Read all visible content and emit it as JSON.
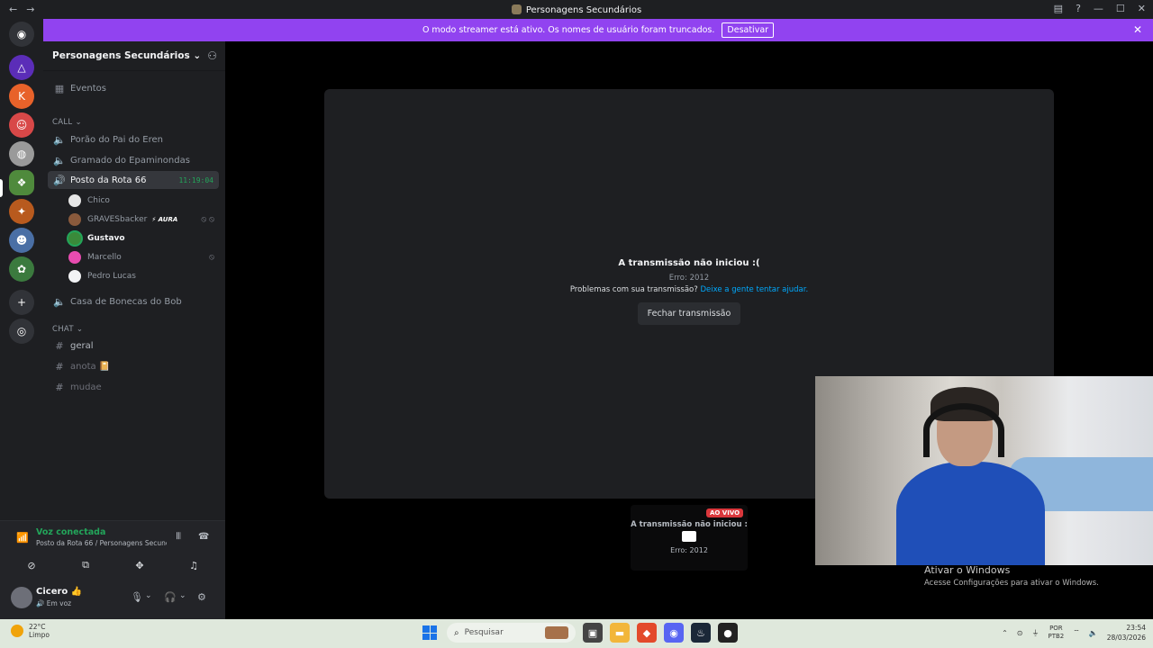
{
  "window": {
    "title": "Personagens Secundários",
    "back": "←",
    "forward": "→",
    "inbox_icon": "inbox-icon",
    "help_icon": "?",
    "minimize": "—",
    "maximize": "☐",
    "close": "✕"
  },
  "banner": {
    "text": "O modo streamer está ativo. Os nomes de usuário foram truncados.",
    "button": "Desativar",
    "close": "✕",
    "color": "#9143f0"
  },
  "servers": [
    {
      "name": "home-discord",
      "glyph": "◉",
      "color": "#313338"
    },
    {
      "name": "server-1",
      "glyph": "△",
      "color": "#5b2db8"
    },
    {
      "name": "server-2",
      "glyph": "K",
      "color": "#e8622a"
    },
    {
      "name": "server-3",
      "glyph": "☺",
      "color": "#d84848"
    },
    {
      "name": "server-4",
      "glyph": "◍",
      "color": "#9a9a9a"
    },
    {
      "name": "server-5",
      "glyph": "❖",
      "color": "#4f8a3c"
    },
    {
      "name": "server-6",
      "glyph": "✦",
      "color": "#b85a1e"
    },
    {
      "name": "server-7",
      "glyph": "☻",
      "color": "#4a6fa5"
    },
    {
      "name": "server-8",
      "glyph": "✿",
      "color": "#3b7a3e"
    },
    {
      "name": "add-server",
      "glyph": "+",
      "color": "#313338"
    },
    {
      "name": "explore",
      "glyph": "◎",
      "color": "#313338"
    }
  ],
  "guild": {
    "name": "Personagens Secundários",
    "chevron": "⌄",
    "add_member": "⚇"
  },
  "sidebar": {
    "events": "Eventos",
    "call_category": "CALL",
    "chat_category": "CHAT",
    "voice_channels": [
      {
        "name": "Porão do Pai do Eren"
      },
      {
        "name": "Gramado do Epaminondas"
      },
      {
        "name": "Posto da Rota 66",
        "timer": "11:19:04"
      },
      {
        "name": "Casa de Bonecas do Bob"
      }
    ],
    "voice_users": [
      {
        "name": "Chico",
        "avatar": "#e6e6e6",
        "right": ""
      },
      {
        "name": "GRAVESbacker",
        "avatar": "#8a5a3c",
        "badge": "⚡ AURA",
        "right": "⦸ ⦸"
      },
      {
        "name": "Gustavo",
        "avatar": "#3a8a3a",
        "right": "",
        "speaking": true
      },
      {
        "name": "Marcello",
        "avatar": "#e84cb0",
        "right": "⦸"
      },
      {
        "name": "Pedro Lucas",
        "avatar": "#f2f3f5",
        "right": ""
      }
    ],
    "text_channels": [
      {
        "name": "geral"
      },
      {
        "name": "anota 📔"
      },
      {
        "name": "mudae"
      }
    ]
  },
  "voice_panel": {
    "status": "Voz conectada",
    "location": "Posto da Rota 66 / Personagens Secund...",
    "buttons": [
      "camera-off",
      "share-screen",
      "activities",
      "soundboard"
    ],
    "button_glyphs": [
      "⊘",
      "⧉",
      "✥",
      "♫"
    ]
  },
  "user_panel": {
    "name": "Cicero 👍",
    "status": "🔊 Em voz",
    "mic": "🎙",
    "headset": "🎧",
    "settings": "⚙",
    "chev": "⌄"
  },
  "stream": {
    "title": "A transmissão não iniciou :(",
    "error": "Erro: 2012",
    "problem": "Problemas com sua transmissão?",
    "help_link": "Deixe a gente tentar ajudar.",
    "close_button": "Fechar transmissão"
  },
  "mini_stream": {
    "live": "AO VIVO",
    "title": "A transmissão não iniciou :",
    "error": "Erro: 2012"
  },
  "windows_watermark": {
    "title": "Ativar o Windows",
    "subtitle": "Acesse Configurações para ativar o Windows."
  },
  "taskbar": {
    "weather_temp": "22°C",
    "weather_desc": "Limpo",
    "search_placeholder": "Pesquisar",
    "apps": [
      {
        "name": "task-view",
        "glyph": "▣",
        "color": "#444"
      },
      {
        "name": "file-explorer",
        "glyph": "▬",
        "color": "#f2b63a"
      },
      {
        "name": "brave",
        "glyph": "◆",
        "color": "#e34a2b"
      },
      {
        "name": "discord",
        "glyph": "◉",
        "color": "#5865f2"
      },
      {
        "name": "steam",
        "glyph": "♨",
        "color": "#1b2838"
      },
      {
        "name": "other-app",
        "glyph": "●",
        "color": "#222"
      }
    ],
    "lang_top": "POR",
    "lang_bottom": "PTB2",
    "time": "23:54",
    "date": "28/03/2026"
  }
}
